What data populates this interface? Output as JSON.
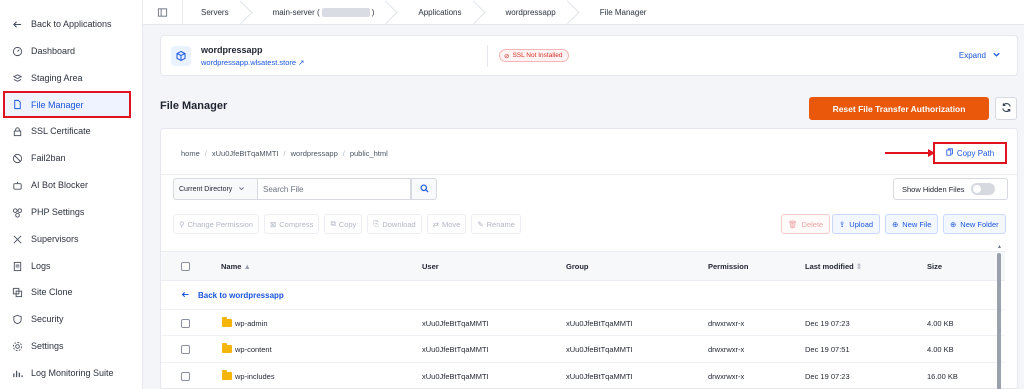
{
  "sidebar": {
    "items": [
      {
        "label": "Back to Applications",
        "icon": "arrow-left-icon"
      },
      {
        "label": "Dashboard",
        "icon": "gauge-icon"
      },
      {
        "label": "Staging Area",
        "icon": "layers-icon"
      },
      {
        "label": "File Manager",
        "icon": "file-icon",
        "active": true
      },
      {
        "label": "SSL Certificate",
        "icon": "lock-icon"
      },
      {
        "label": "Fail2ban",
        "icon": "ban-icon"
      },
      {
        "label": "AI Bot Blocker",
        "icon": "robot-icon"
      },
      {
        "label": "PHP Settings",
        "icon": "php-icon"
      },
      {
        "label": "Supervisors",
        "icon": "tools-icon"
      },
      {
        "label": "Logs",
        "icon": "log-icon"
      },
      {
        "label": "Site Clone",
        "icon": "clone-icon"
      },
      {
        "label": "Security",
        "icon": "shield-icon"
      },
      {
        "label": "Settings",
        "icon": "gear-icon"
      },
      {
        "label": "Log Monitoring Suite",
        "icon": "chart-icon"
      }
    ]
  },
  "breadcrumb": {
    "servers": "Servers",
    "server_prefix": "main-server (",
    "server_suffix": ")",
    "applications": "Applications",
    "app": "wordpressapp",
    "current": "File Manager"
  },
  "app_card": {
    "name": "wordpressapp",
    "url": "wordpressapp.wlsatest.store",
    "ssl_badge": "SSL Not Installed",
    "expand_label": "Expand"
  },
  "header": {
    "title": "File Manager",
    "reset_button": "Reset File Transfer Authorization"
  },
  "path": {
    "segments": [
      "home",
      "xUu0JfeBtTqaMMTI",
      "wordpressapp",
      "public_html"
    ],
    "copy_label": "Copy Path"
  },
  "filter": {
    "scope": "Current Directory",
    "search_placeholder": "Search File",
    "hidden_label": "Show Hidden Files"
  },
  "toolbar": {
    "change_permission": "Change Permission",
    "compress": "Compress",
    "copy": "Copy",
    "download": "Download",
    "move": "Move",
    "rename": "Rename",
    "delete": "Delete",
    "upload": "Upload",
    "new_file": "New File",
    "new_folder": "New Folder"
  },
  "table": {
    "columns": [
      "Name",
      "User",
      "Group",
      "Permission",
      "Last modified",
      "Size"
    ],
    "back_label": "Back to wordpressapp",
    "rows": [
      {
        "name": "wp-admin",
        "user": "xUu0JfeBtTqaMMTI",
        "group": "xUu0JfeBtTqaMMTI",
        "permission": "drwxrwxr-x",
        "modified": "Dec 19 07:23",
        "size": "4.00 KB"
      },
      {
        "name": "wp-content",
        "user": "xUu0JfeBtTqaMMTI",
        "group": "xUu0JfeBtTqaMMTI",
        "permission": "drwxrwxr-x",
        "modified": "Dec 19 07:51",
        "size": "4.00 KB"
      },
      {
        "name": "wp-includes",
        "user": "xUu0JfeBtTqaMMTI",
        "group": "xUu0JfeBtTqaMMTI",
        "permission": "drwxrwxr-x",
        "modified": "Dec 19 07:23",
        "size": "16.00 KB"
      }
    ]
  },
  "colors": {
    "accent": "#1a56db",
    "orange": "#ea580c",
    "highlight": "#e0141e"
  }
}
